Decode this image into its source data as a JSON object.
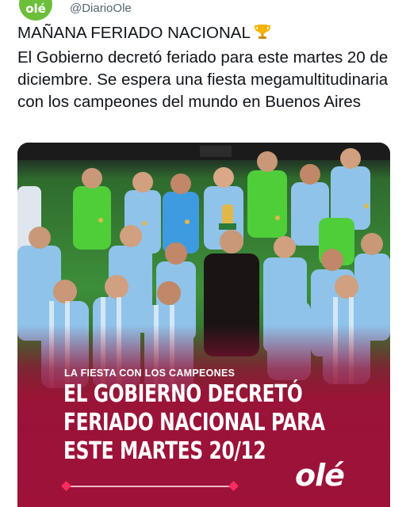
{
  "tweet": {
    "avatar_text": "olé",
    "handle": "@DiarioOle",
    "headline": "MAÑANA FERIADO NACIONAL",
    "headline_emoji": "trophy-emoji",
    "body": "El Gobierno decretó feriado para este martes 20 de diciembre. Se espera una fiesta megamultitudinaria con los campeones del mundo en Buenos Aires"
  },
  "media": {
    "kicker": "LA FIESTA CON LOS CAMPEONES",
    "headline_lines": [
      "EL GOBIERNO DECRETÓ",
      "FERIADO NACIONAL PARA",
      "ESTE MARTES 20/12"
    ],
    "brand": "olé",
    "colors": {
      "overlay": "#9e1238",
      "accent": "#ff2b5e",
      "jersey_blue": "#8fc3ea",
      "goalkeeper_green": "#4fce3a",
      "brand_green": "#6bbf3a"
    }
  }
}
